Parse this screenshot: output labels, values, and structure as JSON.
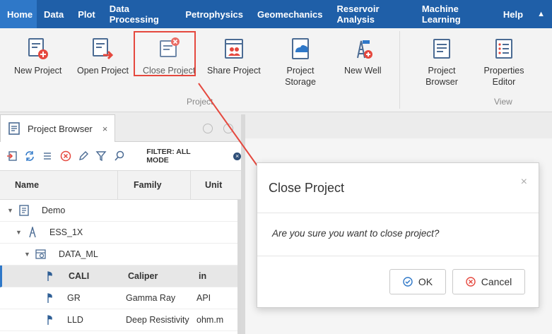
{
  "menu": {
    "items": [
      "Home",
      "Data",
      "Plot",
      "Data Processing",
      "Petrophysics",
      "Geomechanics",
      "Reservoir Analysis",
      "Machine Learning",
      "Help"
    ],
    "collapse_glyph": "▲"
  },
  "ribbon": {
    "buttons": [
      {
        "label": "New Project",
        "icon": "new-project-icon"
      },
      {
        "label": "Open Project",
        "icon": "open-project-icon"
      },
      {
        "label": "Close Project",
        "icon": "close-project-icon"
      },
      {
        "label": "Share Project",
        "icon": "share-project-icon"
      },
      {
        "label": "Project Storage",
        "icon": "cloud-storage-icon"
      },
      {
        "label": "New Well",
        "icon": "new-well-icon"
      },
      {
        "label": "Project Browser",
        "icon": "project-browser-icon"
      },
      {
        "label": "Properties Editor",
        "icon": "properties-editor-icon"
      }
    ],
    "groups": [
      "Project",
      "View"
    ]
  },
  "panel": {
    "tab_label": "Project Browser",
    "tab_close": "×",
    "filter_label": "FILTER: ALL MODE",
    "columns": [
      "Name",
      "Family",
      "Unit"
    ],
    "tree": [
      {
        "name": "Demo",
        "family": "",
        "unit": "",
        "level": 0,
        "icon": "project-icon"
      },
      {
        "name": "ESS_1X",
        "family": "",
        "unit": "",
        "level": 1,
        "icon": "well-icon"
      },
      {
        "name": "DATA_ML",
        "family": "",
        "unit": "",
        "level": 2,
        "icon": "dataset-icon"
      },
      {
        "name": "CALI",
        "family": "Caliper",
        "unit": "in",
        "level": 3,
        "icon": "curve-icon",
        "selected": true
      },
      {
        "name": "GR",
        "family": "Gamma Ray",
        "unit": "API",
        "level": 3,
        "icon": "curve-icon"
      },
      {
        "name": "LLD",
        "family": "Deep Resistivity",
        "unit": "ohm.m",
        "level": 3,
        "icon": "curve-icon"
      }
    ]
  },
  "dialog": {
    "title": "Close Project",
    "close_glyph": "×",
    "message": "Are you sure you want to close project?",
    "ok_label": "OK",
    "cancel_label": "Cancel"
  },
  "colors": {
    "menubar": "#1f5fa8",
    "accent": "#2f78c8",
    "highlight": "#e5483e"
  }
}
